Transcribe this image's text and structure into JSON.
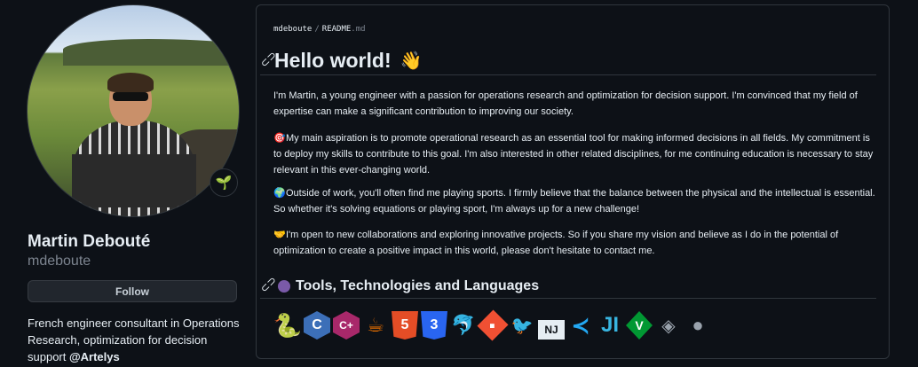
{
  "profile": {
    "name": "Martin Debouté",
    "login": "mdeboute",
    "follow_label": "Follow",
    "status_emoji": "🌱",
    "bio_text": "French engineer consultant in Operations Research, optimization for decision support ",
    "bio_org": "@Artelys"
  },
  "readme": {
    "breadcrumb": {
      "owner": "mdeboute",
      "separator": "/",
      "file": "README",
      "ext": ".md"
    },
    "heading": "Hello world!",
    "heading_emoji": "👋",
    "paragraphs": [
      {
        "emoji": "",
        "text": "I'm Martin, a young engineer with a passion for operations research and optimization for decision support. I'm convinced that my field of expertise can make a significant contribution to improving our society."
      },
      {
        "emoji": "🎯",
        "text": "My main aspiration is to promote operational research as an essential tool for making informed decisions in all fields. My commitment is to deploy my skills to contribute to this goal. I'm also interested in other related disciplines, for me continuing education is necessary to stay relevant in this ever-changing world."
      },
      {
        "emoji": "🌍",
        "text": "Outside of work, you'll often find me playing sports. I firmly believe that the balance between the physical and the intellectual is essential. So whether it's solving equations or playing sport, I'm always up for a new challenge!"
      },
      {
        "emoji": "🤝",
        "text": "I'm open to new collaborations and exploring innovative projects. So if you share my vision and believe as I do in the potential of optimization to create a positive impact in this world, please don't hesitate to contact me."
      }
    ],
    "tools_heading": "Tools, Technologies and Languages",
    "tools": [
      {
        "name": "python-icon",
        "glyph": "🐍"
      },
      {
        "name": "c-icon",
        "glyph": "C"
      },
      {
        "name": "cpp-icon",
        "glyph": "C+"
      },
      {
        "name": "java-icon",
        "glyph": "☕"
      },
      {
        "name": "html5-icon",
        "glyph": "5"
      },
      {
        "name": "css3-icon",
        "glyph": "3"
      },
      {
        "name": "mysql-icon",
        "glyph": "🐬"
      },
      {
        "name": "git-icon",
        "glyph": "◆"
      },
      {
        "name": "bird-icon",
        "glyph": "🐦"
      },
      {
        "name": "nodejs-icon",
        "glyph": "NJ"
      },
      {
        "name": "vscode-icon",
        "glyph": "≺"
      },
      {
        "name": "julia-icon",
        "glyph": "JI"
      },
      {
        "name": "vim-icon",
        "glyph": "V"
      },
      {
        "name": "unity-icon",
        "glyph": "◈"
      },
      {
        "name": "apple-icon",
        "glyph": ""
      }
    ]
  },
  "colors": {
    "background": "#0d1117",
    "border": "#30363d",
    "text": "#e6edf3",
    "muted": "#7d8590",
    "button_bg": "#21262d"
  }
}
